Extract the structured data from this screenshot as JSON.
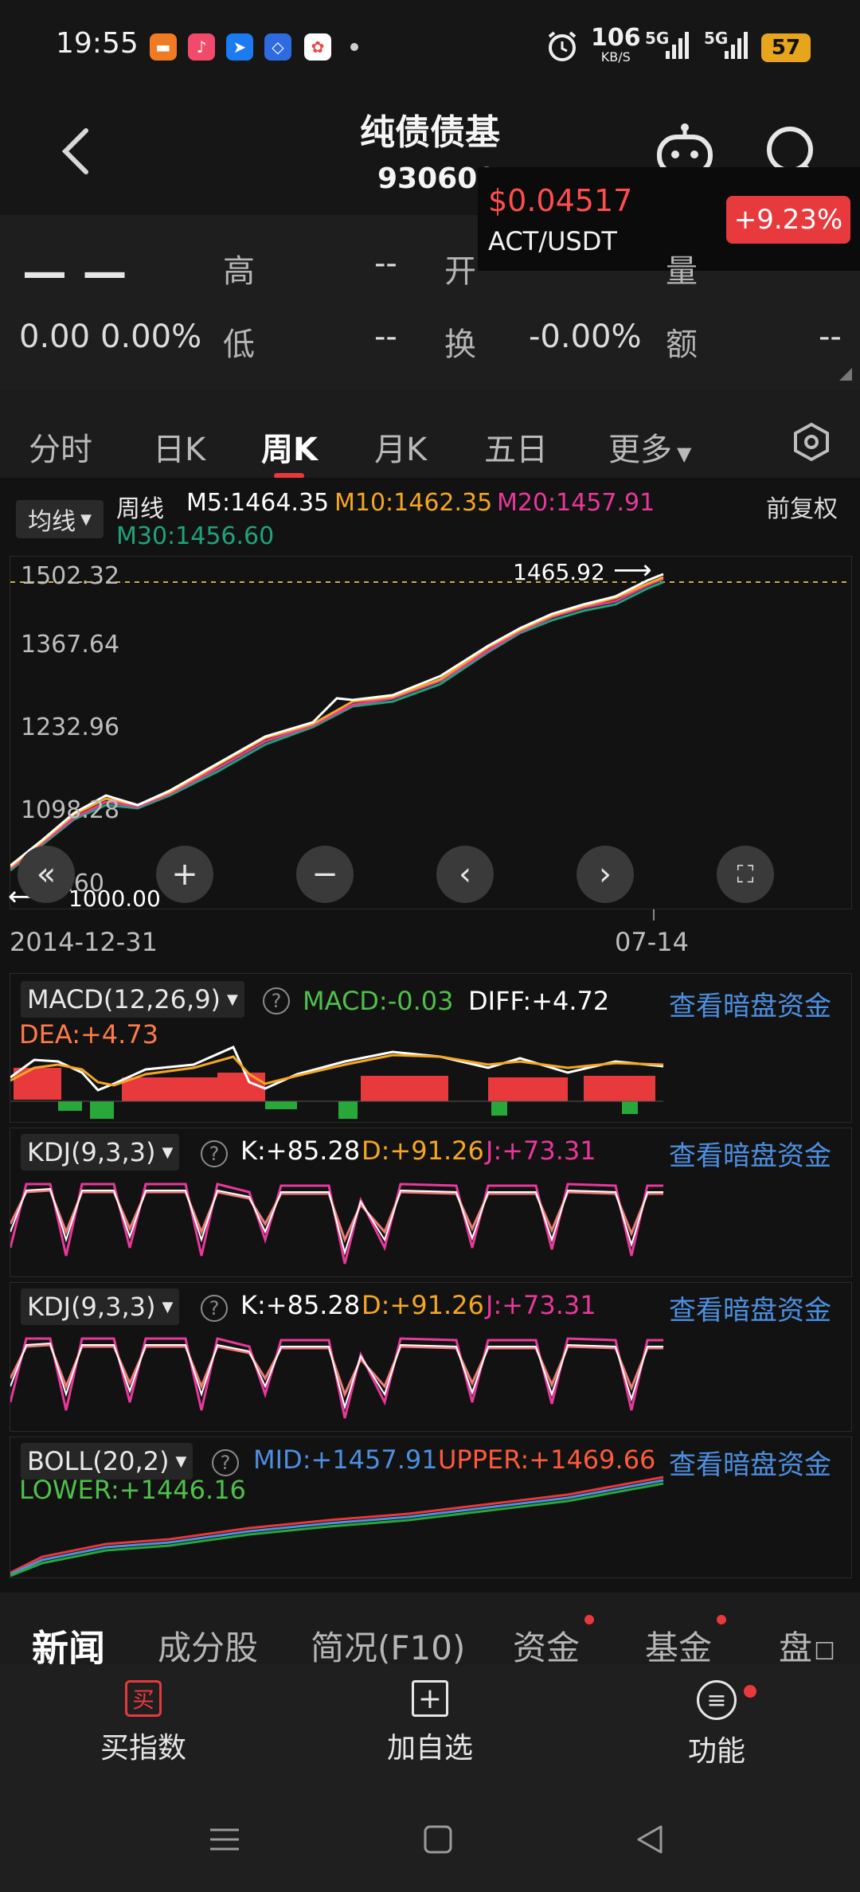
{
  "status": {
    "time": "19:55",
    "net_speed": "106",
    "net_unit": "KB/S",
    "signal1": "5G",
    "signal2": "5G",
    "battery": "57"
  },
  "header": {
    "title": "纯债债基",
    "code": "930609"
  },
  "ticker": {
    "price": "$0.04517",
    "pair": "ACT/USDT",
    "change": "+9.23%"
  },
  "quote": {
    "big_price": "— —",
    "change": "0.00",
    "change_pct": "0.00%",
    "fields": [
      {
        "label": "高",
        "value": "--"
      },
      {
        "label": "开",
        "value": "--"
      },
      {
        "label": "量",
        "value": "--"
      },
      {
        "label": "低",
        "value": "--"
      },
      {
        "label": "换",
        "value": "-0.00%"
      },
      {
        "label": "额",
        "value": "--"
      }
    ]
  },
  "tabs": [
    "分时",
    "日K",
    "周K",
    "月K",
    "五日",
    "更多"
  ],
  "active_tab": "周K",
  "ma": {
    "selector": "均线",
    "period": "周线",
    "m5": "M5:1464.35",
    "m10": "M10:1462.35",
    "m20": "M20:1457.91",
    "m30": "M30:1456.60",
    "adjust": "前复权"
  },
  "main_chart": {
    "y_ticks": [
      "1502.32",
      "1367.64",
      "1232.96",
      "1098.28",
      "963.60"
    ],
    "high_label": "1465.92",
    "low_label": "1000.00",
    "x_start": "2014-12-31",
    "x_end": "07-14"
  },
  "macd": {
    "name": "MACD(12,26,9)",
    "macd": "MACD:-0.03",
    "diff": "DIFF:+4.72",
    "dea": "DEA:+4.73",
    "link": "查看暗盘资金"
  },
  "kdj1": {
    "name": "KDJ(9,3,3)",
    "k": "K:+85.28",
    "d": "D:+91.26",
    "j": "J:+73.31",
    "link": "查看暗盘资金"
  },
  "kdj2": {
    "name": "KDJ(9,3,3)",
    "k": "K:+85.28",
    "d": "D:+91.26",
    "j": "J:+73.31",
    "link": "查看暗盘资金"
  },
  "boll": {
    "name": "BOLL(20,2)",
    "mid": "MID:+1457.91",
    "upper": "UPPER:+1469.66",
    "lower": "LOWER:+1446.16",
    "link": "查看暗盘资金"
  },
  "news_tabs": [
    "新闻",
    "成分股",
    "简况(F10)",
    "资金",
    "基金",
    "盘"
  ],
  "actions": [
    {
      "label": "买指数",
      "icon": "买"
    },
    {
      "label": "加自选"
    },
    {
      "label": "功能"
    }
  ],
  "colors": {
    "red": "#e8393d",
    "m5": "#ffffff",
    "m10": "#f5a623",
    "m20": "#e8389a",
    "m30": "#1fa37a",
    "blue_link": "#4d8fe0"
  }
}
